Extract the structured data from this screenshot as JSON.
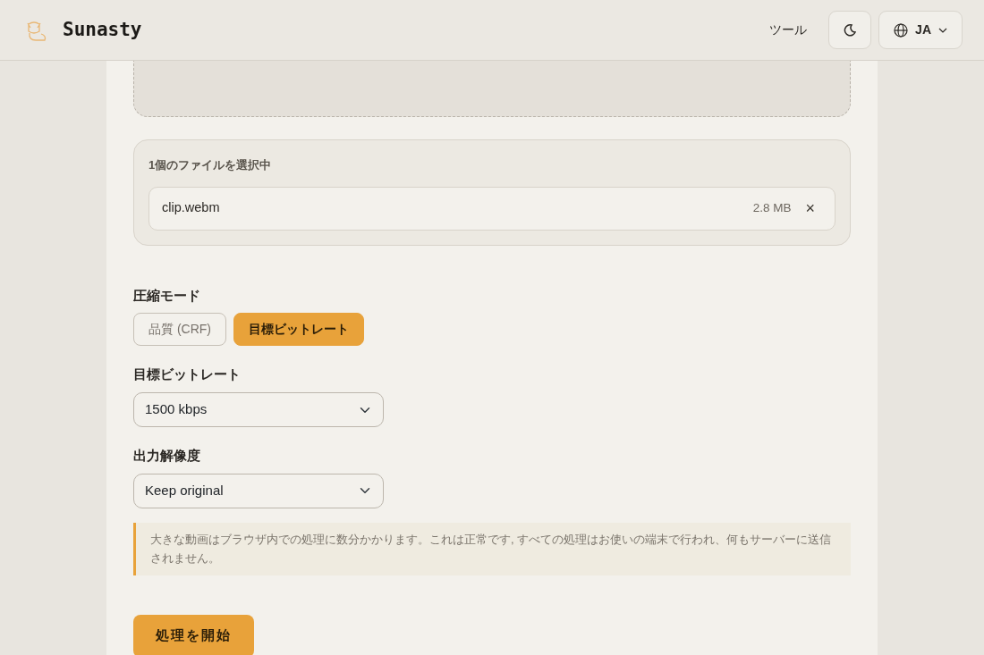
{
  "header": {
    "brand": "Sunasty",
    "nav_link": "ツール",
    "language": "JA"
  },
  "files": {
    "summary": "1個のファイルを選択中",
    "items": [
      {
        "name": "clip.webm",
        "size": "2.8 MB",
        "remove": "×"
      }
    ]
  },
  "mode": {
    "label": "圧縮モード",
    "options": [
      {
        "label": "品質 (CRF)",
        "selected": false
      },
      {
        "label": "目標ビットレート",
        "selected": true
      }
    ]
  },
  "bitrate": {
    "label": "目標ビットレート",
    "value": "1500 kbps"
  },
  "resolution": {
    "label": "出力解像度",
    "value": "Keep original"
  },
  "notice": "大きな動画はブラウザ内での処理に数分かかります。これは正常です, すべての処理はお使いの端末で行われ、何もサーバーに送信されません。",
  "start_button": "処理を開始"
}
